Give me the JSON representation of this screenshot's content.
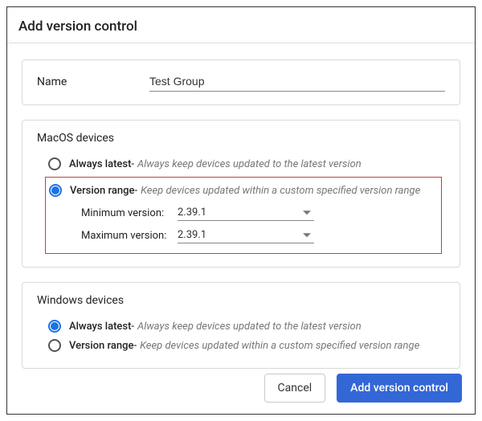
{
  "dialog": {
    "title": "Add version control"
  },
  "name_section": {
    "label": "Name",
    "value": "Test Group"
  },
  "radio_options": {
    "always_latest_label": "Always latest",
    "always_latest_desc": "Always keep devices updated to the latest version",
    "version_range_label": "Version range",
    "version_range_desc": "Keep devices updated within a custom specified version range"
  },
  "macos_section": {
    "title": "MacOS devices",
    "min_label": "Minimum version:",
    "min_value": "2.39.1",
    "max_label": "Maximum version:",
    "max_value": "2.39.1"
  },
  "windows_section": {
    "title": "Windows devices"
  },
  "footer": {
    "cancel": "Cancel",
    "submit": "Add version control"
  }
}
